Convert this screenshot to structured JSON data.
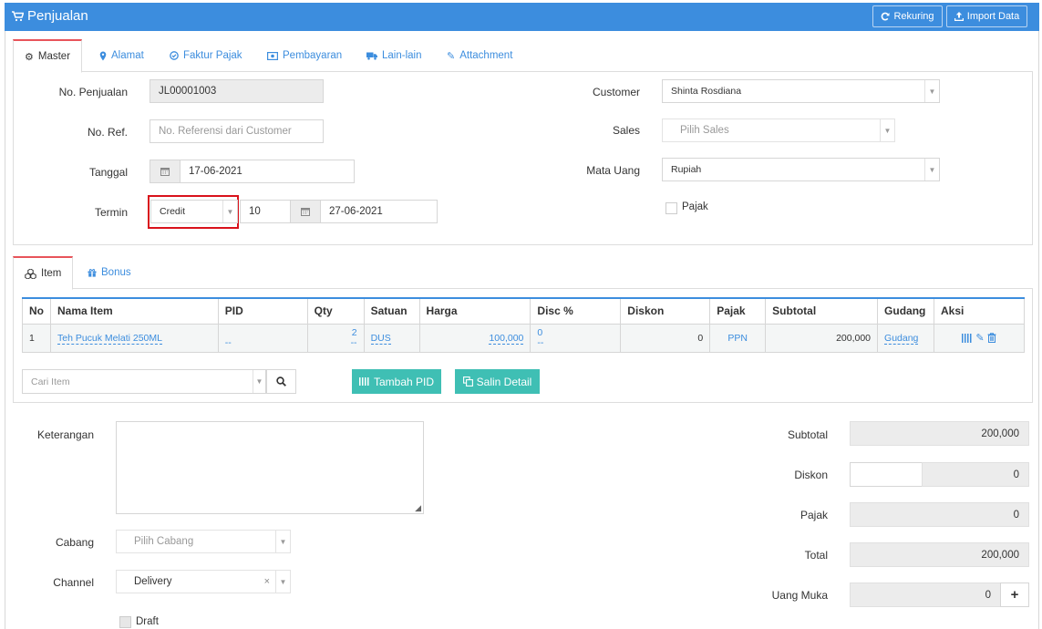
{
  "header": {
    "title": "Penjualan",
    "rekuring_label": "Rekuring",
    "import_label": "Import Data"
  },
  "tabs": [
    {
      "label": "Master",
      "icon": "cogs-icon"
    },
    {
      "label": "Alamat",
      "icon": "map-marker-icon"
    },
    {
      "label": "Faktur Pajak",
      "icon": "check-circle-icon"
    },
    {
      "label": "Pembayaran",
      "icon": "money-icon"
    },
    {
      "label": "Lain-lain",
      "icon": "truck-icon"
    },
    {
      "label": "Attachment",
      "icon": "paperclip-icon"
    }
  ],
  "form": {
    "no_penjualan_label": "No. Penjualan",
    "no_penjualan_value": "JL00001003",
    "no_ref_label": "No. Ref.",
    "no_ref_placeholder": "No. Referensi dari Customer",
    "tanggal_label": "Tanggal",
    "tanggal_value": "17-06-2021",
    "termin_label": "Termin",
    "termin_type": "Credit",
    "termin_days": "10",
    "termin_due": "27-06-2021",
    "customer_label": "Customer",
    "customer_value": "Shinta Rosdiana",
    "sales_label": "Sales",
    "sales_placeholder": "Pilih Sales",
    "mata_uang_label": "Mata Uang",
    "mata_uang_value": "Rupiah",
    "pajak_label": "Pajak"
  },
  "subtabs": [
    {
      "label": "Item",
      "icon": "cubes-icon"
    },
    {
      "label": "Bonus",
      "icon": "gift-icon"
    }
  ],
  "table": {
    "headers": [
      "No",
      "Nama Item",
      "PID",
      "Qty",
      "Satuan",
      "Harga",
      "Disc %",
      "Diskon",
      "Pajak",
      "Subtotal",
      "Gudang",
      "Aksi"
    ],
    "row": {
      "no": "1",
      "nama": "Teh Pucuk Melati 250ML",
      "pid": "--",
      "qty": "2",
      "qty_sub": "--",
      "satuan": "DUS",
      "harga": "100,000",
      "disc": "0",
      "disc_sub": "--",
      "diskon": "0",
      "pajak": "PPN",
      "subtotal": "200,000",
      "gudang": "Gudang"
    }
  },
  "item_search": {
    "placeholder": "Cari Item"
  },
  "buttons": {
    "tambah_pid": "Tambah PID",
    "salin_detail": "Salin Detail"
  },
  "footer": {
    "keterangan_label": "Keterangan",
    "cabang_label": "Cabang",
    "cabang_placeholder": "Pilih Cabang",
    "channel_label": "Channel",
    "channel_value": "Delivery",
    "draft_label": "Draft",
    "subtotal_label": "Subtotal",
    "subtotal_value": "200,000",
    "diskon_label": "Diskon",
    "diskon_value": "0",
    "pajak_label": "Pajak",
    "pajak_value": "0",
    "total_label": "Total",
    "total_value": "200,000",
    "uang_muka_label": "Uang Muka",
    "uang_muka_value": "0"
  },
  "colors": {
    "primary": "#3c8dde",
    "teal": "#3fbfb4",
    "highlight": "#d9121b"
  }
}
